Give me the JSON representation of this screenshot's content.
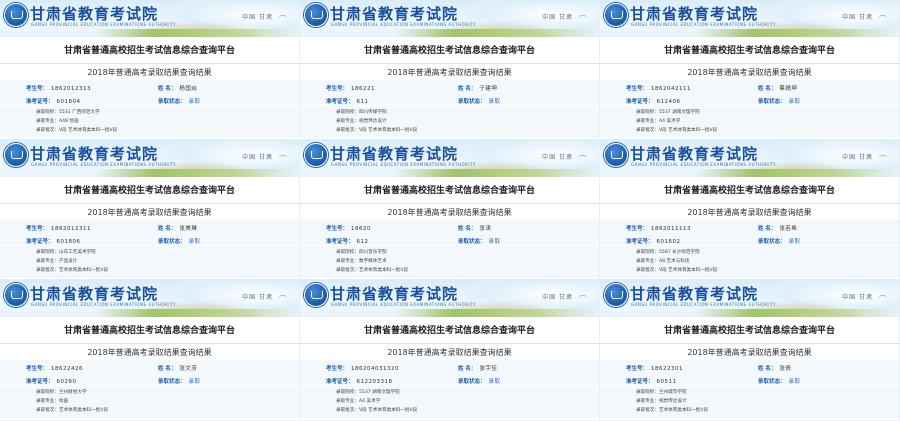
{
  "header": {
    "site_name": "甘肃省教育考试院",
    "site_subtitle": "GANSU PROVINCIAL EDUCATION EXAMINATIONS AUTHORITY",
    "region": "中国 甘肃"
  },
  "platform_title": "甘肃省普通高校招生考试信息综合查询平台",
  "result_title": "2018年普通高考录取结果查询结果",
  "labels": {
    "exam_no": "考生号：",
    "ticket_no": "准考证号：",
    "name": "姓 名：",
    "status": "录取状态：",
    "school": "录取院校：",
    "major": "录取专业：",
    "batch": "录取批次："
  },
  "records": [
    {
      "exam_no": "1862012313",
      "ticket_no": "601804",
      "name": "杨国焱",
      "status": "录取",
      "school": "5531 广西师范大学",
      "major": "A48 绘画",
      "batch": "V段 艺术体育类本科一批V段"
    },
    {
      "exam_no": "186221",
      "ticket_no": "611",
      "name": "于建坤",
      "status": "录取",
      "school": "四川传媒学院",
      "major": "视觉传达设计",
      "batch": "V段 艺术体育类本科一批V段"
    },
    {
      "exam_no": "1862042111",
      "ticket_no": "612406",
      "name": "蔡婧坤",
      "status": "录取",
      "school": "5537 湖南文理学院",
      "major": "A4 美术学",
      "batch": "V段 艺术体育类本科一批V段"
    },
    {
      "exam_no": "1862012311",
      "ticket_no": "601806",
      "name": "张美琳",
      "status": "录取",
      "school": "山东工艺美术学院",
      "major": "产品设计",
      "batch": "艺术体育类本科一批V段"
    },
    {
      "exam_no": "18620",
      "ticket_no": "612",
      "name": "张涛",
      "status": "录取",
      "school": "四川音乐学院",
      "major": "数字媒体艺术",
      "batch": "艺术体育类本科一批V段"
    },
    {
      "exam_no": "1862011113",
      "ticket_no": "601602",
      "name": "张若希",
      "status": "录取",
      "school": "5587 长沙师范学院",
      "major": "A8 艺术与科技",
      "batch": "V段 艺术体育类本科一批V段"
    },
    {
      "exam_no": "18622426",
      "ticket_no": "60260",
      "name": "张文芳",
      "status": "录取",
      "school": "兰州财经大学",
      "major": "绘画",
      "batch": "艺术体育类本科一批V段"
    },
    {
      "exam_no": "186204031320",
      "ticket_no": "612203318",
      "name": "张宇佳",
      "status": "录取",
      "school": "5537 湖南文理学院",
      "major": "A4 美术学",
      "batch": "V段 艺术体育类本科一批V段"
    },
    {
      "exam_no": "18622301",
      "ticket_no": "60511",
      "name": "张倩",
      "status": "录取",
      "school": "兰州城市学院",
      "major": "视觉传达设计",
      "batch": "艺术体育类本科一批V段"
    }
  ]
}
